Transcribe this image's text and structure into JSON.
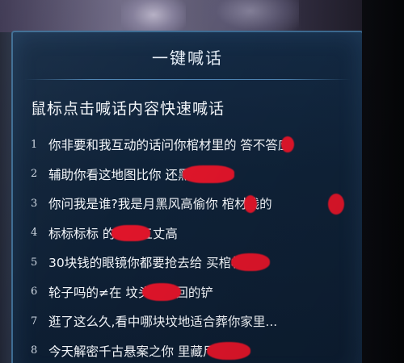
{
  "dialog": {
    "title": "一键喊话",
    "subtitle": "鼠标点击喊话内容快速喊话"
  },
  "messages": [
    {
      "number": "1",
      "text": "你非要和我互动的话问你棺材里的  答不答应"
    },
    {
      "number": "2",
      "text": "辅助你看这地图比你        还黑"
    },
    {
      "number": "3",
      "text": "你问我是谁?我是月黑风高偷你  棺材钱的"
    },
    {
      "number": "4",
      "text": "标标标标     的坟草五丈高"
    },
    {
      "number": "5",
      "text": "30块钱的眼镜你都要抢去给      买棺材"
    },
    {
      "number": "6",
      "text": "轮子吗的≠在      坟头上来回的铲"
    },
    {
      "number": "7",
      "text": "逛了这么久,看中哪块坟地适合葬你家里..."
    },
    {
      "number": "8",
      "text": "今天解密千古悬案之你      里藏尸案"
    }
  ],
  "colors": {
    "panel_bg": "#0f2238",
    "panel_border": "#3d6c93",
    "text": "#f4f7fb",
    "censor": "#e0152a"
  }
}
